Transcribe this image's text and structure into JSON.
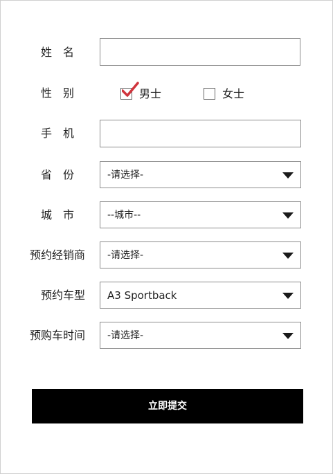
{
  "form": {
    "name_label": "姓名",
    "gender_label": "性别",
    "gender_options": [
      {
        "label": "男士",
        "checked": true
      },
      {
        "label": "女士",
        "checked": false
      }
    ],
    "phone_label": "手机",
    "province_label": "省份",
    "province_value": "-请选择-",
    "city_label": "城市",
    "city_value": "--城市--",
    "dealer_label": "预约经销商",
    "dealer_value": "-请选择-",
    "model_label": "预约车型",
    "model_value": "A3 Sportback",
    "purchase_time_label": "预购车时间",
    "purchase_time_value": "-请选择-",
    "submit_label": "立即提交"
  },
  "colors": {
    "check_accent": "#d0343c",
    "submit_bg": "#000000",
    "submit_text": "#ffffff",
    "border": "#8a8a8a"
  },
  "icons": {
    "gender_male_checked": "checkmark-icon",
    "select_caret": "caret-down-icon"
  }
}
